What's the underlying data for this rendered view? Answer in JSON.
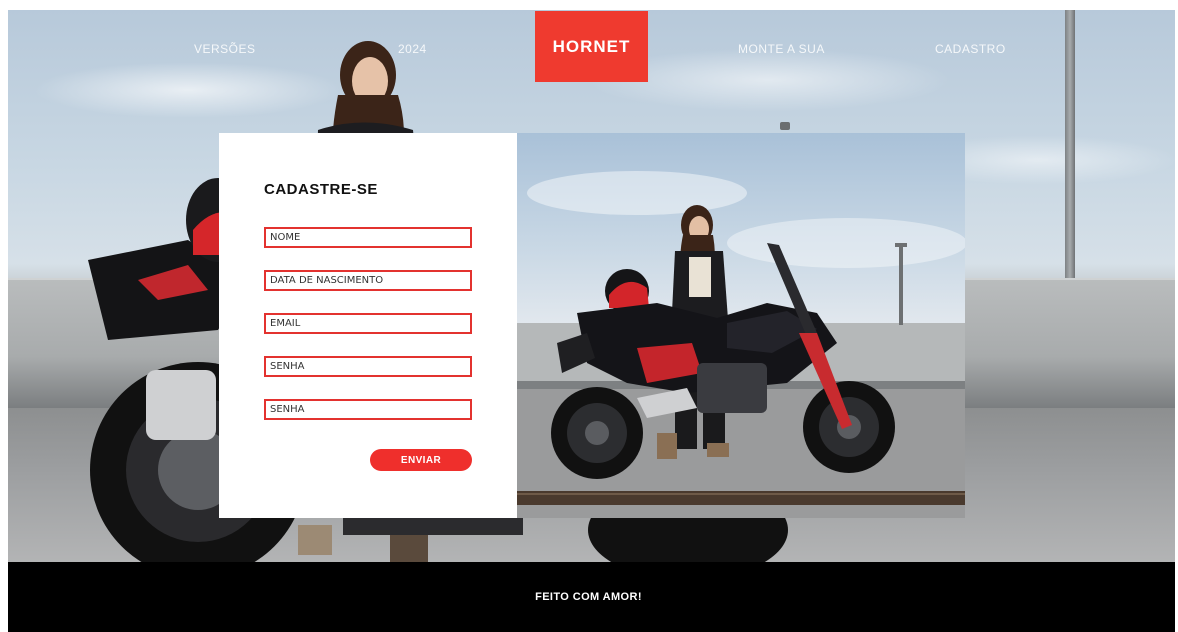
{
  "nav": {
    "items": [
      {
        "label": "VERSÕES"
      },
      {
        "label": "2024"
      },
      {
        "label": "MONTE A SUA"
      },
      {
        "label": "CADASTRO"
      }
    ],
    "logo_text": "HORNET"
  },
  "form": {
    "title": "CADASTRE-SE",
    "fields": [
      {
        "placeholder": "NOME",
        "value": ""
      },
      {
        "placeholder": "DATA DE NASCIMENTO",
        "value": ""
      },
      {
        "placeholder": "EMAIL",
        "value": ""
      },
      {
        "placeholder": "SENHA",
        "value": ""
      },
      {
        "placeholder": "SENHA",
        "value": ""
      }
    ],
    "submit_label": "ENVIAR"
  },
  "footer": {
    "text": "FEITO COM AMOR!"
  },
  "colors": {
    "brand_red": "#ef3a2f",
    "field_border": "#e3322f",
    "footer_bg": "#000000"
  }
}
